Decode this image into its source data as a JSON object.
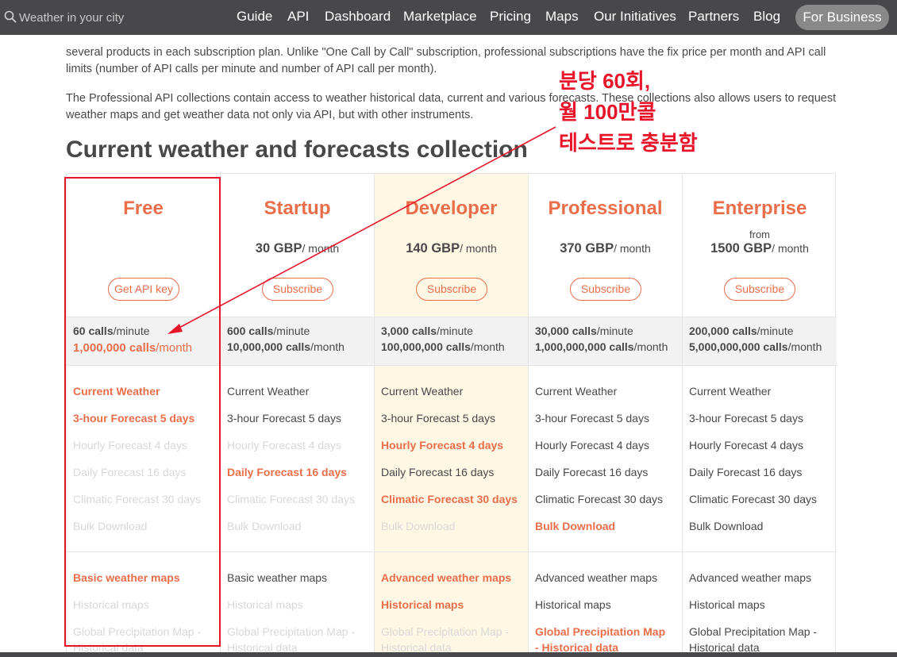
{
  "search": {
    "placeholder": "Weather in your city"
  },
  "nav": {
    "items": [
      "Guide",
      "API",
      "Dashboard",
      "Marketplace",
      "Pricing",
      "Maps",
      "Our Initiatives",
      "Partners",
      "Blog"
    ],
    "for_business": "For Business"
  },
  "intro": {
    "p1": "several products in each subscription plan. Unlike \"One Call by Call\" subscription, professional subscriptions have the fix price per month and API call limits (number of API calls per minute and number of API call per month).",
    "p2": "The Professional API collections contain access to weather historical data, current and various forecasts. These collections also allows users to request weather maps and get weather data not only via API, but with other instruments."
  },
  "section_title": "Current weather and forecasts collection",
  "annotation": {
    "line1": "분당 60회,",
    "line2": "월 100만콜",
    "line3": "테스트로 충분함"
  },
  "plans": [
    {
      "name": "Free",
      "from": "",
      "price": "",
      "unit": "",
      "button": "Get API key",
      "calls_min": "60 calls",
      "calls_min_unit": "/minute",
      "calls_month": "1,000,000 calls",
      "calls_month_unit": "/month",
      "features": [
        {
          "label": "Current Weather",
          "state": "on"
        },
        {
          "label": "3-hour Forecast 5 days",
          "state": "on"
        },
        {
          "label": "Hourly Forecast 4 days",
          "state": "off"
        },
        {
          "label": "Daily Forecast 16 days",
          "state": "off"
        },
        {
          "label": "Climatic Forecast 30 days",
          "state": "off"
        },
        {
          "label": "Bulk Download",
          "state": "off"
        }
      ],
      "maps": [
        {
          "label": "Basic weather maps",
          "state": "on"
        },
        {
          "label": "Historical maps",
          "state": "off"
        },
        {
          "label": "Global Precipitation Map -",
          "state": "off"
        },
        {
          "label": "Historical data",
          "state": "off"
        }
      ]
    },
    {
      "name": "Startup",
      "from": "",
      "price": "30 GBP",
      "unit": "/ month",
      "button": "Subscribe",
      "calls_min": "600 calls",
      "calls_min_unit": "/minute",
      "calls_month": "10,000,000 calls",
      "calls_month_unit": "/month",
      "features": [
        {
          "label": "Current Weather",
          "state": "plain"
        },
        {
          "label": "3-hour Forecast 5 days",
          "state": "plain"
        },
        {
          "label": "Hourly Forecast 4 days",
          "state": "off"
        },
        {
          "label": "Daily Forecast 16 days",
          "state": "on"
        },
        {
          "label": "Climatic Forecast 30 days",
          "state": "off"
        },
        {
          "label": "Bulk Download",
          "state": "off"
        }
      ],
      "maps": [
        {
          "label": "Basic weather maps",
          "state": "plain"
        },
        {
          "label": "Historical maps",
          "state": "off"
        },
        {
          "label": "Global Precipitation Map -",
          "state": "off"
        },
        {
          "label": "Historical data",
          "state": "off"
        }
      ]
    },
    {
      "name": "Developer",
      "from": "",
      "price": "140 GBP",
      "unit": "/ month",
      "button": "Subscribe",
      "calls_min": "3,000 calls",
      "calls_min_unit": "/minute",
      "calls_month": "100,000,000 calls",
      "calls_month_unit": "/month",
      "features": [
        {
          "label": "Current Weather",
          "state": "plain"
        },
        {
          "label": "3-hour Forecast 5 days",
          "state": "plain"
        },
        {
          "label": "Hourly Forecast 4 days",
          "state": "on"
        },
        {
          "label": "Daily Forecast 16 days",
          "state": "plain"
        },
        {
          "label": "Climatic Forecast 30 days",
          "state": "on"
        },
        {
          "label": "Bulk Download",
          "state": "off"
        }
      ],
      "maps": [
        {
          "label": "Advanced weather maps",
          "state": "on"
        },
        {
          "label": "Historical maps",
          "state": "on"
        },
        {
          "label": "Global Precipitation Map -",
          "state": "off"
        },
        {
          "label": "Historical data",
          "state": "off"
        }
      ]
    },
    {
      "name": "Professional",
      "from": "",
      "price": "370 GBP",
      "unit": "/ month",
      "button": "Subscribe",
      "calls_min": "30,000 calls",
      "calls_min_unit": "/minute",
      "calls_month": "1,000,000,000 calls",
      "calls_month_unit": "/month",
      "features": [
        {
          "label": "Current Weather",
          "state": "plain"
        },
        {
          "label": "3-hour Forecast 5 days",
          "state": "plain"
        },
        {
          "label": "Hourly Forecast 4 days",
          "state": "plain"
        },
        {
          "label": "Daily Forecast 16 days",
          "state": "plain"
        },
        {
          "label": "Climatic Forecast 30 days",
          "state": "plain"
        },
        {
          "label": "Bulk Download",
          "state": "on"
        }
      ],
      "maps": [
        {
          "label": "Advanced weather maps",
          "state": "plain"
        },
        {
          "label": "Historical maps",
          "state": "plain"
        },
        {
          "label": "Global Precipitation Map",
          "state": "on"
        },
        {
          "label": "- Historical data",
          "state": "on"
        }
      ]
    },
    {
      "name": "Enterprise",
      "from": "from",
      "price": "1500 GBP",
      "unit": "/ month",
      "button": "Subscribe",
      "calls_min": "200,000 calls",
      "calls_min_unit": "/minute",
      "calls_month": "5,000,000,000 calls",
      "calls_month_unit": "/month",
      "features": [
        {
          "label": "Current Weather",
          "state": "plain"
        },
        {
          "label": "3-hour Forecast 5 days",
          "state": "plain"
        },
        {
          "label": "Hourly Forecast 4 days",
          "state": "plain"
        },
        {
          "label": "Daily Forecast 16 days",
          "state": "plain"
        },
        {
          "label": "Climatic Forecast 30 days",
          "state": "plain"
        },
        {
          "label": "Bulk Download",
          "state": "plain"
        }
      ],
      "maps": [
        {
          "label": "Advanced weather maps",
          "state": "plain"
        },
        {
          "label": "Historical maps",
          "state": "plain"
        },
        {
          "label": "Global Precipitation Map -",
          "state": "plain"
        },
        {
          "label": "Historical data",
          "state": "plain"
        }
      ]
    }
  ],
  "colors": {
    "accent": "#eb6e4b",
    "nav_bg": "#48484a",
    "highlight_col": "#fdf7e4",
    "annotation": "#e8142a"
  },
  "icons": {
    "search": "search-icon"
  }
}
